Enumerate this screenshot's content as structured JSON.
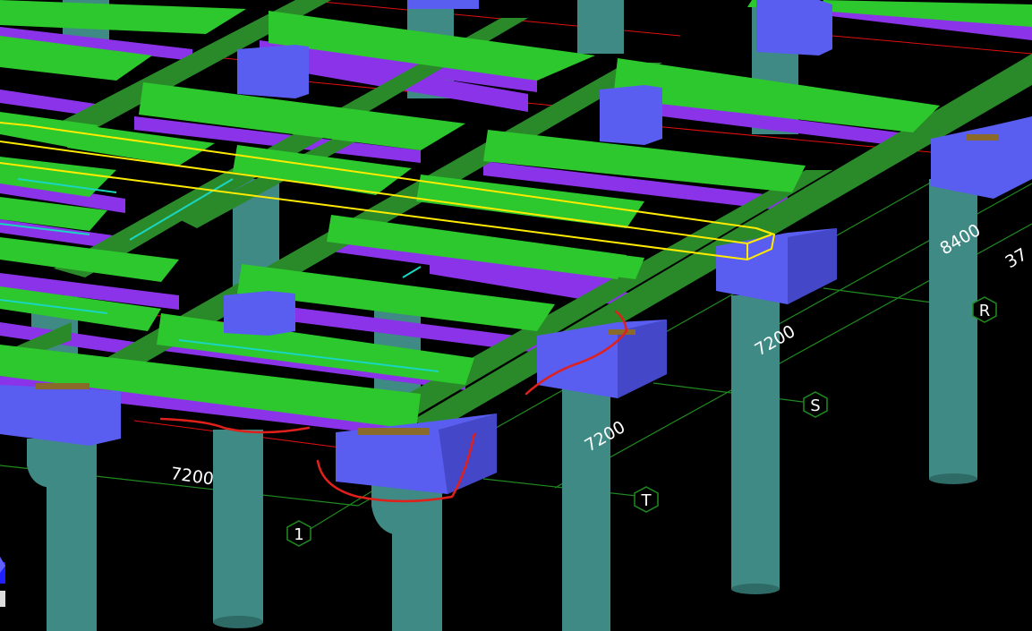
{
  "colors": {
    "background": "#000000",
    "column": "#3f8a84",
    "column_shade": "#2e6a66",
    "main_girder": "#2a8a2a",
    "secondary_beam_top": "#2dc82d",
    "beam_side_purple": "#8a33e8",
    "beam_dark_purple": "#6b22c4",
    "cap_blue": "#5a5ef0",
    "cap_blue_dark": "#4347c8",
    "grid_line": "#1f8a1f",
    "red_line": "#e01010",
    "highlight": "#ffea00",
    "annotation_red": "#e0201a"
  },
  "dimensions": [
    {
      "id": "dim-bottom-7200",
      "text": "7200"
    },
    {
      "id": "dim-st-7200",
      "text": "7200"
    },
    {
      "id": "dim-rs-7200",
      "text": "7200"
    },
    {
      "id": "dim-8400",
      "text": "8400"
    },
    {
      "id": "dim-partial",
      "text": "37"
    }
  ],
  "grid_bubbles": [
    {
      "id": "grid-1",
      "label": "1"
    },
    {
      "id": "grid-T",
      "label": "T"
    },
    {
      "id": "grid-S",
      "label": "S"
    },
    {
      "id": "grid-R",
      "label": "R"
    }
  ],
  "icons": {
    "view_cube": "axis-triad-icon"
  }
}
